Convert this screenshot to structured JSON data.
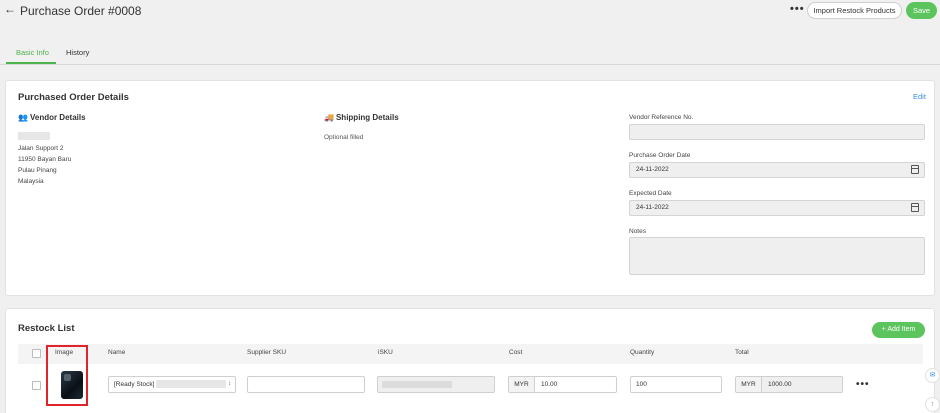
{
  "header": {
    "title": "Purchase Order #0008",
    "import_label": "Import Restock Products",
    "save_label": "Save"
  },
  "tabs": [
    {
      "label": "Basic Info",
      "active": true
    },
    {
      "label": "History",
      "active": false
    }
  ],
  "details": {
    "title": "Purchased Order Details",
    "edit_label": "Edit",
    "vendor": {
      "title": "Vendor Details",
      "address": [
        "Jalan Support 2",
        "11950 Bayan Baru",
        "Pulau Pinang",
        "Malaysia"
      ]
    },
    "shipping": {
      "title": "Shipping Details",
      "note": "Optional filled"
    },
    "fields": {
      "vendor_ref_label": "Vendor Reference No.",
      "vendor_ref_value": "",
      "po_date_label": "Purchase Order Date",
      "po_date_value": "24-11-2022",
      "expected_label": "Expected Date",
      "expected_value": "24-11-2022",
      "notes_label": "Notes",
      "notes_value": ""
    }
  },
  "restock": {
    "title": "Restock List",
    "add_label": "Add Item",
    "columns": [
      "Image",
      "Name",
      "Supplier SKU",
      "iSKU",
      "Cost",
      "Quantity",
      "Total"
    ],
    "row": {
      "name": "[Ready Stock]",
      "supplier_sku": "",
      "currency": "MYR",
      "cost": "10.00",
      "quantity": "100",
      "total_currency": "MYR",
      "total": "1000.00"
    }
  },
  "colors": {
    "accent_green": "#5cc45c",
    "link_blue": "#3a8ee0",
    "highlight_red": "#e0252a"
  }
}
